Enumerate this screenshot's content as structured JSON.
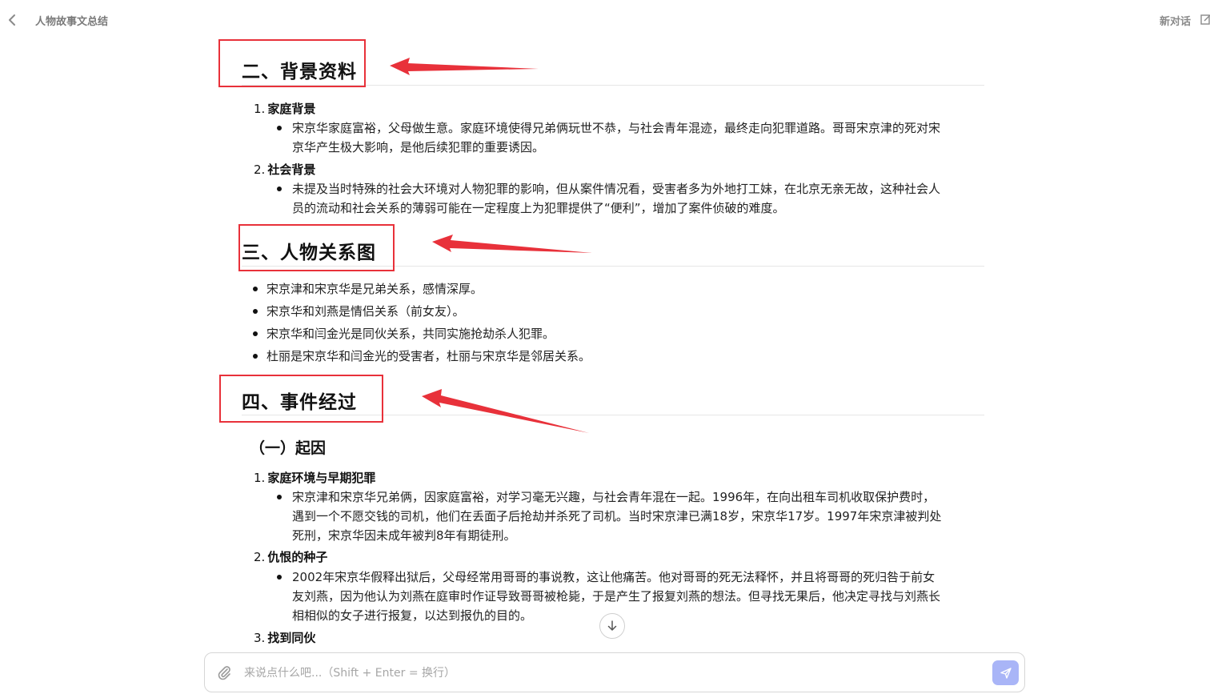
{
  "header": {
    "title": "人物故事文总结",
    "new_chat_label": "新对话"
  },
  "sections": {
    "background": {
      "heading": "二、背景资料",
      "items": [
        {
          "number": "1.",
          "title": "家庭背景",
          "bullet": [
            "宋京华家庭富裕，父母做生意。家庭环境使得兄弟俩玩世不恭，与社会青年混迹，最终走向犯罪道路。哥哥宋京津的死对宋",
            "京华产生极大影响，是他后续犯罪的重要诱因。"
          ]
        },
        {
          "number": "2.",
          "title": "社会背景",
          "bullet": [
            "未提及当时特殊的社会大环境对人物犯罪的影响，但从案件情况看，受害者多为外地打工妹，在北京无亲无故，这种社会人",
            "员的流动和社会关系的薄弱可能在一定程度上为犯罪提供了“便利”，增加了案件侦破的难度。"
          ]
        }
      ]
    },
    "relations": {
      "heading": "三、人物关系图",
      "bullets": [
        "宋京津和宋京华是兄弟关系，感情深厚。",
        "宋京华和刘燕是情侣关系（前女友）。",
        "宋京华和闫金光是同伙关系，共同实施抢劫杀人犯罪。",
        "杜丽是宋京华和闫金光的受害者，杜丽与宋京华是邻居关系。"
      ]
    },
    "events": {
      "heading": "四、事件经过",
      "subheading": "（一）起因",
      "items": [
        {
          "number": "1.",
          "title": "家庭环境与早期犯罪",
          "bullet": [
            "宋京津和宋京华兄弟俩，因家庭富裕，对学习毫无兴趣，与社会青年混在一起。1996年，在向出租车司机收取保护费时，",
            "遇到一个不愿交钱的司机，他们在丢面子后抢劫并杀死了司机。当时宋京津已满18岁，宋京华17岁。1997年宋京津被判处",
            "死刑，宋京华因未成年被判8年有期徒刑。"
          ]
        },
        {
          "number": "2.",
          "title": "仇恨的种子",
          "bullet": [
            "2002年宋京华假释出狱后，父母经常用哥哥的事说教，这让他痛苦。他对哥哥的死无法释怀，并且将哥哥的死归咎于前女",
            "友刘燕，因为他认为刘燕在庭审时作证导致哥哥被枪毙，于是产生了报复刘燕的想法。但寻找无果后，他决定寻找与刘燕长",
            "相相似的女子进行报复，以达到报仇的目的。"
          ]
        },
        {
          "number": "3.",
          "title": "找到同伙"
        }
      ]
    }
  },
  "composer": {
    "placeholder": "来说点什么吧...（Shift + Enter = 换行）"
  },
  "colors": {
    "annotation_red": "#e8313a",
    "send_button": "#a9b5f7"
  }
}
